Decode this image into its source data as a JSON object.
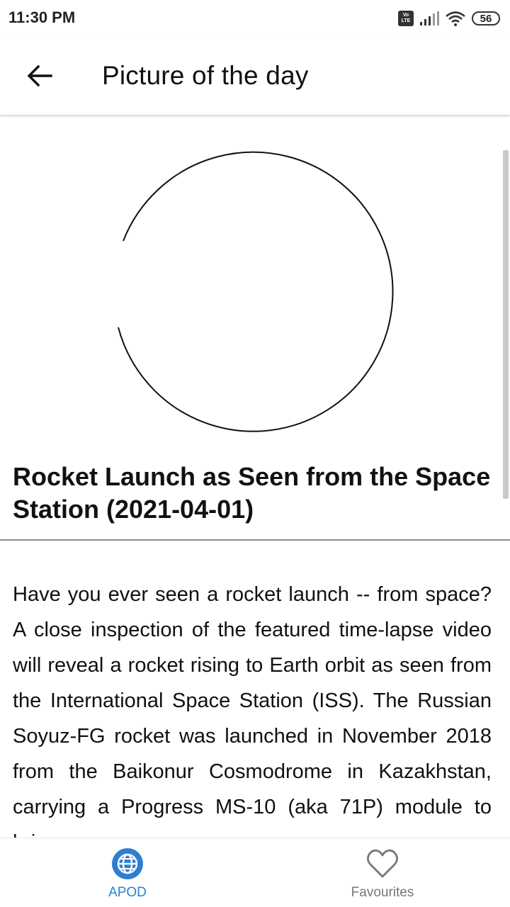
{
  "status_bar": {
    "time": "11:30 PM",
    "volte_top": "Vo",
    "volte_bottom": "LTE",
    "battery": "56"
  },
  "app_bar": {
    "title": "Picture of the day",
    "back_icon": "arrow-left-icon"
  },
  "content": {
    "image_state": "loading-spinner",
    "title": "Rocket Launch as Seen from the Space Station (2021-04-01)",
    "explanation": "Have you ever seen a rocket launch -- from space?  A close inspection of the featured time-lapse video will reveal a rocket rising to Earth orbit as seen from the International Space Station (ISS).  The Russian Soyuz-FG rocket was launched in November 2018 from the Baikonur Cosmodrome in Kazakhstan, carrying a Progress MS-10 (aka 71P) module to bring"
  },
  "bottom_nav": {
    "items": [
      {
        "label": "APOD",
        "icon": "globe-icon",
        "active": true
      },
      {
        "label": "Favourites",
        "icon": "heart-icon",
        "active": false
      }
    ]
  },
  "colors": {
    "accent": "#2f7fd0",
    "inactive": "#777777",
    "text": "#111111"
  }
}
